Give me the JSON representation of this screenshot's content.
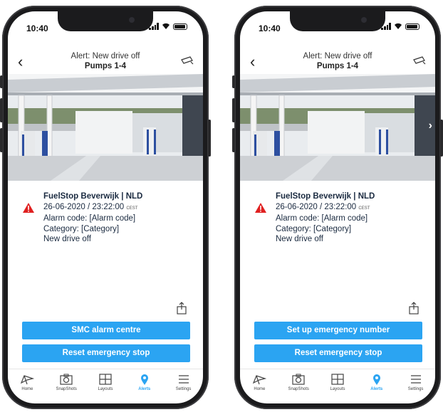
{
  "phones": [
    {
      "status_time": "10:40",
      "header": {
        "title": "Alert: New drive off",
        "subtitle": "Pumps 1-4"
      },
      "alert": {
        "location": "FuelStop Beverwijk | NLD",
        "datetime": "26-06-2020 / 23:22:00",
        "timezone": "CEST",
        "alarm_code": "Alarm code: [Alarm code]",
        "category": "Category: [Category]",
        "description": "New drive off"
      },
      "buttons": {
        "primary": "SMC alarm centre",
        "secondary": "Reset emergency stop"
      },
      "tabs": [
        "Home",
        "SnapShots",
        "Layouts",
        "Alerts",
        "Settings"
      ]
    },
    {
      "status_time": "10:40",
      "header": {
        "title": "Alert: New drive off",
        "subtitle": "Pumps 1-4"
      },
      "alert": {
        "location": "FuelStop Beverwijk | NLD",
        "datetime": "26-06-2020 / 23:22:00",
        "timezone": "CEST",
        "alarm_code": "Alarm code: [Alarm code]",
        "category": "Category: [Category]",
        "description": "New drive off"
      },
      "buttons": {
        "primary": "Set up emergency number",
        "secondary": "Reset emergency stop"
      },
      "tabs": [
        "Home",
        "SnapShots",
        "Layouts",
        "Alerts",
        "Settings"
      ]
    }
  ],
  "active_tab": "Alerts",
  "colors": {
    "accent": "#2ba4f2",
    "warning": "#e02020",
    "text": "#1a2a40"
  },
  "icons": [
    "back-arrow-icon",
    "cctv-camera-icon",
    "warning-triangle-icon",
    "share-icon",
    "home-icon",
    "snapshot-camera-icon",
    "layouts-grid-icon",
    "alerts-location-pin-icon",
    "settings-menu-icon",
    "chevron-right-icon"
  ]
}
